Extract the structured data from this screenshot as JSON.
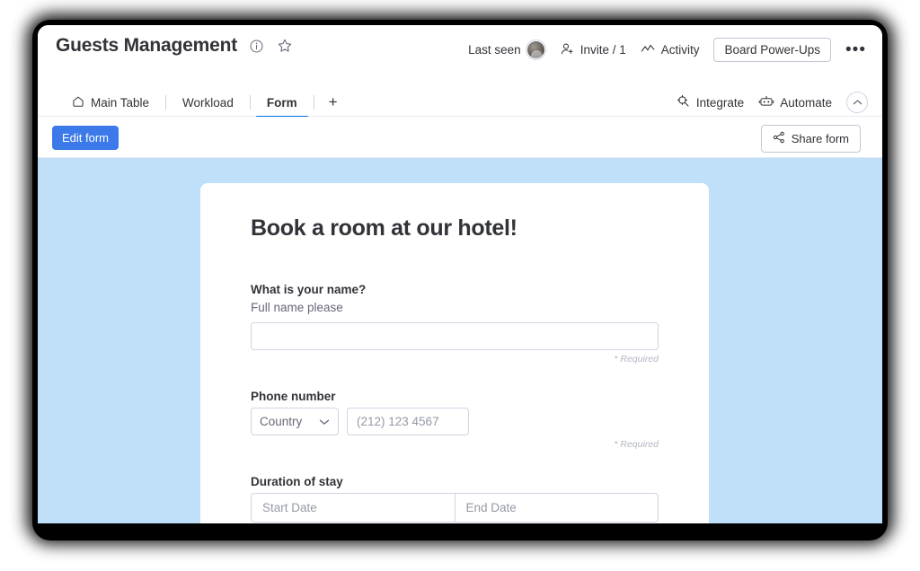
{
  "window": {
    "header": {
      "board_title": "Guests Management",
      "info_icon": "info-circle-icon",
      "favorite_icon": "star-outline-icon",
      "last_seen_label": "Last seen",
      "avatar": "user-avatar",
      "invite_label": "Invite / 1",
      "invite_icon": "person-add-icon",
      "activity_label": "Activity",
      "activity_icon": "activity-line-icon",
      "power_ups_label": "Board Power-Ups",
      "more_label": "•••"
    },
    "tabs": [
      {
        "label": "Main Table",
        "icon": "home-icon",
        "active": false
      },
      {
        "label": "Workload",
        "icon": "",
        "active": false
      },
      {
        "label": "Form",
        "icon": "",
        "active": true
      }
    ],
    "add_tab_label": "+",
    "tabbar_right": {
      "integrate_label": "Integrate",
      "integrate_icon": "integrate-icon",
      "automate_label": "Automate",
      "automate_icon": "robot-icon",
      "collapse_icon": "chevron-up-icon"
    },
    "actionbar": {
      "edit_form_label": "Edit form",
      "share_form_label": "Share form",
      "share_icon": "share-nodes-icon"
    }
  },
  "form": {
    "title": "Book a room at our hotel!",
    "required_note": "* Required",
    "fields": [
      {
        "label": "What is your name?",
        "sublabel": "Full name please",
        "placeholder": "",
        "value": ""
      },
      {
        "label": "Phone number",
        "country_placeholder": "Country",
        "phone_placeholder": "(212) 123 4567",
        "chevron_icon": "chevron-down-icon"
      },
      {
        "label": "Duration of stay",
        "start_placeholder": "Start Date",
        "end_placeholder": "End Date"
      }
    ]
  },
  "colors": {
    "accent_blue": "#0073ea",
    "button_blue": "#3b7ae8",
    "canvas_blue": "#bfe0f8",
    "text_dark": "#323338",
    "text_muted": "#676879"
  }
}
